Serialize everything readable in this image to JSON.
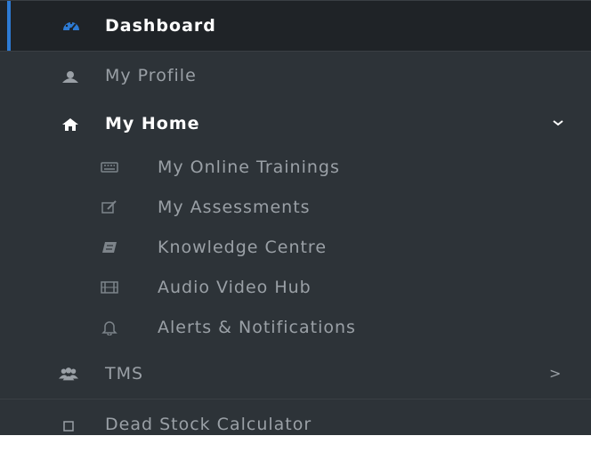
{
  "sidebar": {
    "accent_color": "#2d7bd4",
    "items": [
      {
        "label": "Dashboard",
        "icon": "dashboard-gauge-icon"
      },
      {
        "label": "My Profile",
        "icon": "user-icon"
      },
      {
        "label": "My Home",
        "icon": "home-icon",
        "expanded": true
      },
      {
        "label": "TMS",
        "icon": "users-group-icon",
        "has_children": true
      },
      {
        "label": "Dead Stock Calculator",
        "icon": "square-outline-icon"
      }
    ],
    "submenu": [
      {
        "label": "My Online Trainings",
        "icon": "keyboard-icon"
      },
      {
        "label": "My Assessments",
        "icon": "edit-icon"
      },
      {
        "label": "Knowledge Centre",
        "icon": "book-icon"
      },
      {
        "label": "Audio Video Hub",
        "icon": "film-icon"
      },
      {
        "label": "Alerts & Notifications",
        "icon": "bell-icon"
      }
    ],
    "tms_arrow": ">"
  }
}
